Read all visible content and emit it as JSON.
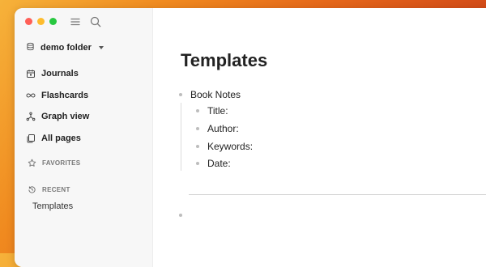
{
  "sidebar": {
    "folder_name": "demo folder",
    "nav": [
      {
        "label": "Journals",
        "icon": "calendar-icon"
      },
      {
        "label": "Flashcards",
        "icon": "infinity-icon"
      },
      {
        "label": "Graph view",
        "icon": "graph-icon"
      },
      {
        "label": "All pages",
        "icon": "pages-icon"
      }
    ],
    "favorites_label": "FAVORITES",
    "recent_label": "RECENT",
    "recent_items": [
      "Templates"
    ]
  },
  "page": {
    "title": "Templates",
    "blocks": [
      {
        "text": "Book Notes",
        "children": [
          "Title:",
          "Author:",
          "Keywords:",
          "Date:"
        ]
      }
    ]
  },
  "colors": {
    "traffic_red": "#ff5f57",
    "traffic_yellow": "#febc2e",
    "traffic_green": "#28c840",
    "background_gradient": [
      "#f6b23a",
      "#e5671a",
      "#b83516"
    ]
  }
}
